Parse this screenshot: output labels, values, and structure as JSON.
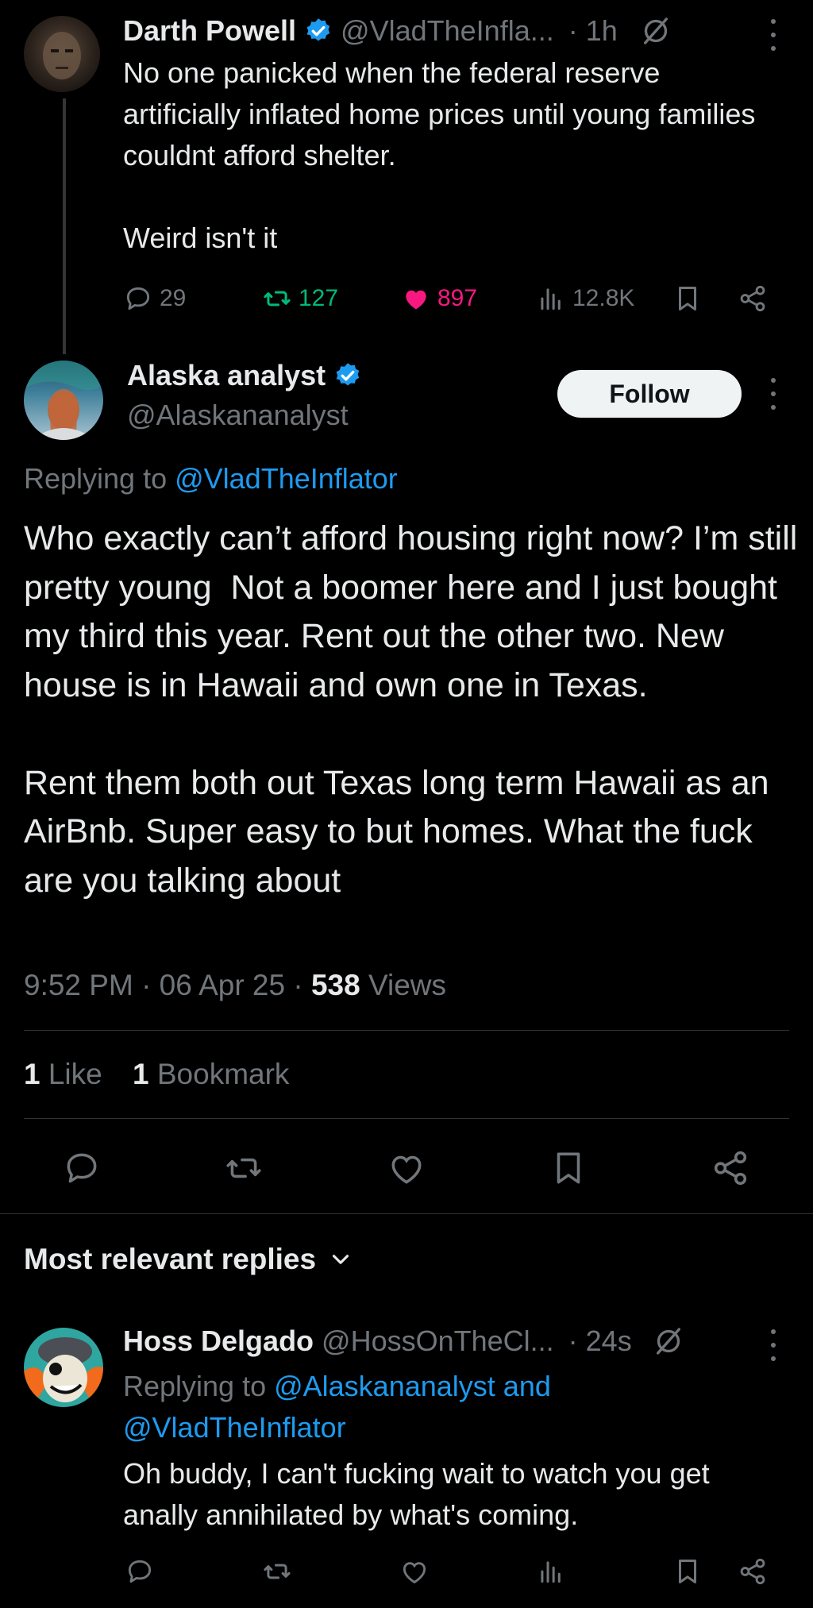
{
  "parent_tweet": {
    "author_name": "Darth Powell",
    "handle": "@VladTheInfla...",
    "time": "· 1h",
    "text": "No one panicked when the federal reserve artificially inflated home prices until young families couldnt afford shelter.\n\nWeird isn't it",
    "replies": "29",
    "reposts": "127",
    "likes": "897",
    "views": "12.8K"
  },
  "main_tweet": {
    "author_name": "Alaska analyst",
    "handle": "@Alaskananalyst",
    "follow_label": "Follow",
    "replying_prefix": "Replying to ",
    "replying_to": "@VladTheInflator",
    "text": "Who exactly can’t afford housing right now? I’m still pretty young  Not a boomer here and I just bought my third this year. Rent out the other two. New house is in Hawaii and own one in Texas.\n\nRent them both out Texas long term Hawaii as an AirBnb. Super easy to but homes. What the fuck are you talking about",
    "timestamp": "9:52 PM · 06 Apr 25 · ",
    "views_count": "538",
    "views_label": " Views",
    "likes_count": "1",
    "likes_label": " Like",
    "bookmarks_count": "1",
    "bookmarks_label": " Bookmark"
  },
  "replies_section": {
    "sort_label": "Most relevant replies"
  },
  "reply": {
    "author_name": "Hoss Delgado",
    "handle": "@HossOnTheCl...",
    "time": "· 24s",
    "replying_prefix": "Replying to ",
    "replying_to": "@Alaskananalyst and @VladTheInflator",
    "text": "Oh buddy, I can't fucking wait to watch you get anally annihilated by what's coming."
  },
  "colors": {
    "background": "#000000",
    "text": "#e7e9ea",
    "secondary": "#71767b",
    "accent": "#1d9bf0",
    "repost": "#00ba7c",
    "like": "#f91880"
  },
  "icons": [
    "verified-icon",
    "grok-icon",
    "reply-icon",
    "repost-icon",
    "like-icon",
    "views-icon",
    "bookmark-icon",
    "share-icon",
    "more-icon",
    "chevron-down-icon"
  ]
}
